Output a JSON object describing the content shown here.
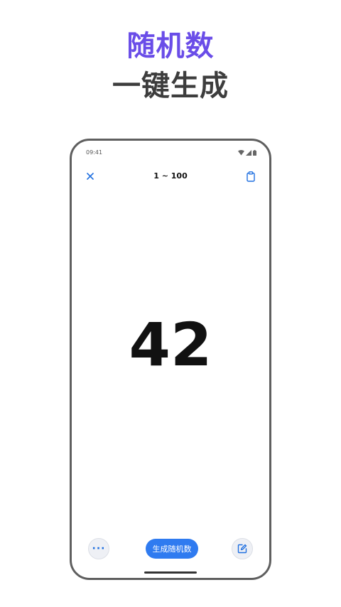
{
  "promo": {
    "headline_primary": "随机数",
    "headline_secondary": "一键生成",
    "primary_color": "#6a4de8",
    "secondary_color": "#3d3d3d"
  },
  "status_bar": {
    "time": "09:41",
    "icons": [
      "wifi-icon",
      "signal-icon",
      "battery-icon"
    ]
  },
  "header": {
    "close_icon": "close-icon",
    "range_title": "1 ~ 100",
    "clipboard_icon": "clipboard-icon"
  },
  "result": {
    "value": "42"
  },
  "bottom_bar": {
    "more_label": "···",
    "generate_label": "生成随机数",
    "edit_icon": "edit-icon",
    "accent_color": "#2f7bf0"
  }
}
